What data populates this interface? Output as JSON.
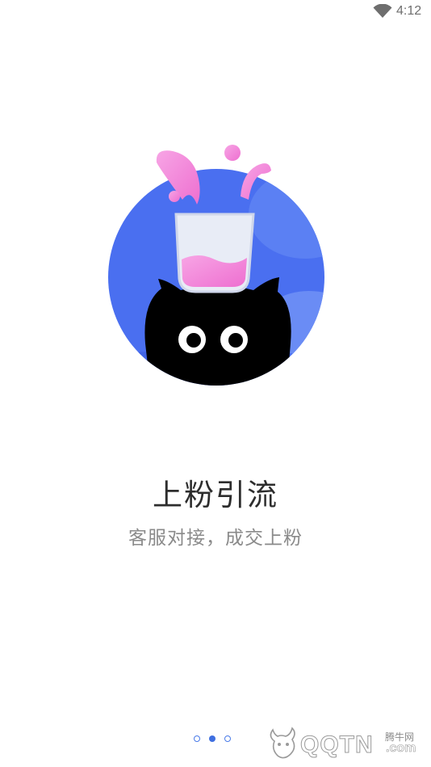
{
  "status_bar": {
    "time": "4:12",
    "wifi_icon": "wifi-icon"
  },
  "onboarding": {
    "illustration": "cat-with-beaker-illustration",
    "title": "上粉引流",
    "subtitle": "客服对接，成交上粉",
    "page_count": 3,
    "active_page": 2
  },
  "watermark": {
    "main": "QQTN",
    "suffix": ".com",
    "chinese": "腾牛网"
  },
  "colors": {
    "circle_blue": "#4a6ff0",
    "pink_liquid": "#f283d8",
    "dot_active": "#3f6fe0",
    "title": "#2d2d2d",
    "subtitle": "#8a8a8a"
  }
}
